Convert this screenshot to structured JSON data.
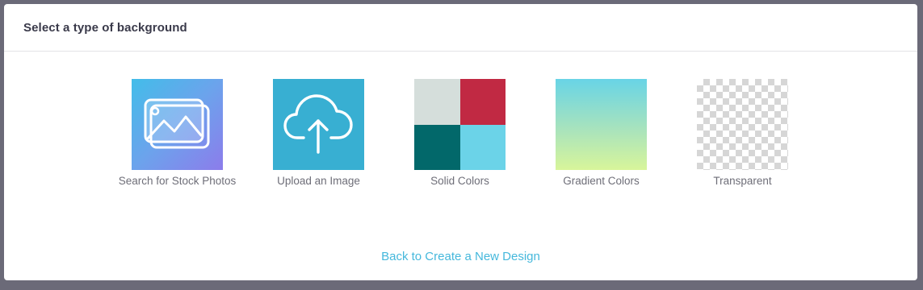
{
  "modal": {
    "title": "Select a type of background"
  },
  "options": [
    {
      "label": "Search for Stock Photos",
      "icon": "stock-photos-icon"
    },
    {
      "label": "Upload an Image",
      "icon": "cloud-upload-icon"
    },
    {
      "label": "Solid Colors",
      "icon": "solid-colors-icon"
    },
    {
      "label": "Gradient Colors",
      "icon": "gradient-colors-icon"
    },
    {
      "label": "Transparent",
      "icon": "transparent-icon"
    }
  ],
  "solid_colors": [
    "#d5dedb",
    "#c12943",
    "#02686a",
    "#6bd3e8"
  ],
  "colors": {
    "link": "#45b8dc",
    "upload_tile": "#38afd2",
    "overlay": "#6b6a78"
  },
  "footer": {
    "back_link": "Back to Create a New Design"
  }
}
